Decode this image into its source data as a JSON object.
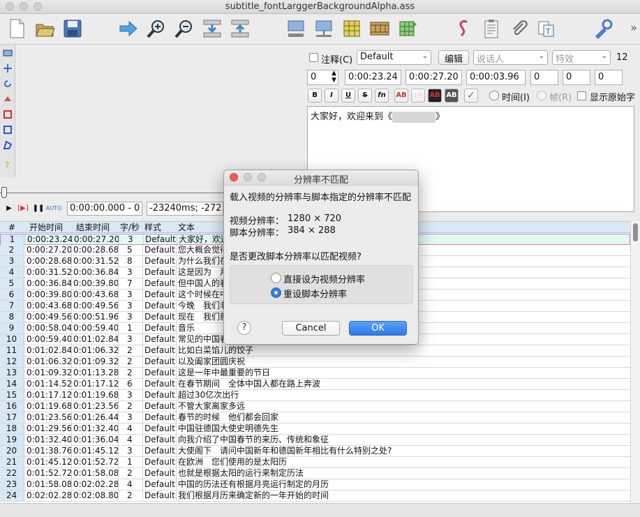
{
  "window": {
    "title": "subtitle_fontLarggerBackgroundAlpha.ass"
  },
  "toolbar": {
    "more": "»"
  },
  "edit": {
    "comment_label": "注释(C)",
    "style_value": "Default",
    "edit_button": "编辑",
    "actor_placeholder": "说话人",
    "effect_placeholder": "特效",
    "font_size": "12",
    "layer": "0",
    "start_time": "0:00:23.24",
    "end_time": "0:00:27.20",
    "duration": "0:00:03.96",
    "margin_l": "0",
    "margin_r": "0",
    "margin_v": "0",
    "fmt_bold": "B",
    "fmt_italic": "I",
    "fmt_underline": "U",
    "fmt_strike": "S",
    "fmt_font": "fn",
    "fmt_colors": [
      "AB",
      "AB",
      "AB",
      "AB"
    ],
    "time_label": "时间(I)",
    "frame_label": "帧(R)",
    "show_original_label": "显示原始字",
    "text_value": "大家好，欢迎来到《",
    "text_suffix": "》"
  },
  "player": {
    "time_field": "0:00:00.000 - 0",
    "offset_field": "-23240ms; -272"
  },
  "grid": {
    "headers": [
      "#",
      "开始时间",
      "结束时间",
      "字/秒",
      "样式",
      "文本"
    ],
    "rows": [
      [
        "1",
        "0:00:23.24",
        "0:00:27.20",
        "3",
        "Default",
        "大家好，欢迎"
      ],
      [
        "2",
        "0:00:27.20",
        "0:00:28.68",
        "5",
        "Default",
        "您大概会觉得"
      ],
      [
        "3",
        "0:00:28.68",
        "0:00:31.52",
        "8",
        "Default",
        "为什么我们在"
      ],
      [
        "4",
        "0:00:31.52",
        "0:00:36.84",
        "3",
        "Default",
        "这是因为　月"
      ],
      [
        "5",
        "0:00:36.84",
        "0:00:39.80",
        "7",
        "Default",
        "但中国人的春"
      ],
      [
        "6",
        "0:00:39.80",
        "0:00:43.68",
        "3",
        "Default",
        "这个时候在中"
      ],
      [
        "7",
        "0:00:43.68",
        "0:00:49.56",
        "3",
        "Default",
        "今晚　我们非"
      ],
      [
        "8",
        "0:00:49.56",
        "0:00:51.96",
        "3",
        "Default",
        "现在　我们就"
      ],
      [
        "9",
        "0:00:58.04",
        "0:00:59.40",
        "1",
        "Default",
        "音乐"
      ],
      [
        "10",
        "0:00:59.40",
        "0:01:02.84",
        "3",
        "Default",
        "常见的中国春"
      ],
      [
        "11",
        "0:01:02.84",
        "0:01:06.32",
        "2",
        "Default",
        "比如白菜馅儿的饺子"
      ],
      [
        "12",
        "0:01:06.32",
        "0:01:09.32",
        "2",
        "Default",
        "以及阖家团圆庆祝"
      ],
      [
        "13",
        "0:01:09.32",
        "0:01:13.28",
        "2",
        "Default",
        "这是一年中最重要的节日"
      ],
      [
        "14",
        "0:01:14.52",
        "0:01:17.12",
        "6",
        "Default",
        "在春节期间　全体中国人都在路上奔波"
      ],
      [
        "15",
        "0:01:17.12",
        "0:01:19.68",
        "3",
        "Default",
        "超过30亿次出行"
      ],
      [
        "16",
        "0:01:19.68",
        "0:01:23.56",
        "2",
        "Default",
        "不管大家离家多远"
      ],
      [
        "17",
        "0:01:23.56",
        "0:01:26.44",
        "3",
        "Default",
        "春节的时候　他们都会回家"
      ],
      [
        "18",
        "0:01:29.56",
        "0:01:32.40",
        "4",
        "Default",
        "中国驻德国大使史明德先生"
      ],
      [
        "19",
        "0:01:32.40",
        "0:01:36.04",
        "4",
        "Default",
        "向我介绍了中国春节的来历、传统和象征"
      ],
      [
        "20",
        "0:01:38.76",
        "0:01:45.12",
        "3",
        "Default",
        "大使阁下　请问中国新年和德国新年相比有什么特别之处?"
      ],
      [
        "21",
        "0:01:45.12",
        "0:01:52.72",
        "1",
        "Default",
        "在欧洲　您们使用的是太阳历"
      ],
      [
        "22",
        "0:01:52.72",
        "0:01:58.08",
        "2",
        "Default",
        "也就是根据太阳的运行来制定历法"
      ],
      [
        "23",
        "0:01:58.08",
        "0:02:02.28",
        "4",
        "Default",
        "中国的历法还有根据月亮运行制定的月历"
      ],
      [
        "24",
        "0:02:02.28",
        "0:02:08.80",
        "2",
        "Default",
        "我们根据月历来确定新的一年开始的时间"
      ]
    ]
  },
  "dialog": {
    "title": "分辨率不匹配",
    "message": "载入视频的分辨率与脚本指定的分辨率不匹配",
    "video_res_label": "视频分辨率：",
    "video_res_value": "1280 × 720",
    "script_res_label": "脚本分辨率：",
    "script_res_value": "384 × 288",
    "question": "是否更改脚本分辨率以匹配视频?",
    "option_set": "直接设为视频分辨率",
    "option_resample": "重设脚本分辨率",
    "selected_option": "重设脚本分辨率",
    "help": "?",
    "cancel": "Cancel",
    "ok": "OK"
  }
}
